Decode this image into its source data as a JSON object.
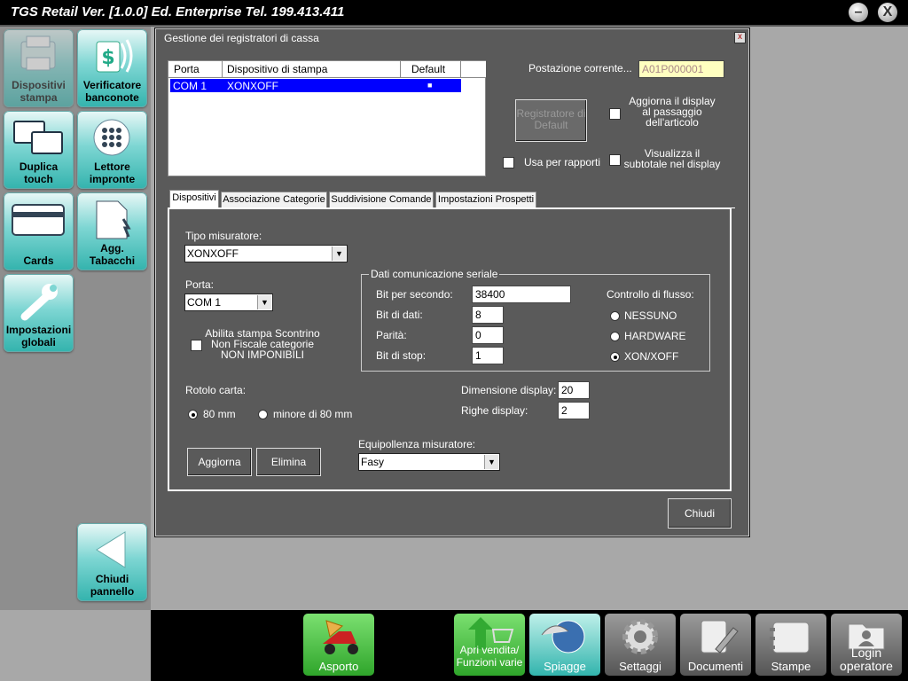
{
  "app": {
    "title": "TGS Retail Ver. [1.0.0] Ed. Enterprise   Tel. 199.413.411",
    "minimize_label": "–",
    "close_label": "X"
  },
  "sidebar": {
    "tiles": [
      {
        "label": "Dispositivi stampa",
        "icon": "printer-device-icon",
        "state": "disabled"
      },
      {
        "label": "Verificatore banconote",
        "icon": "banknote-verifier-icon"
      },
      {
        "label": "Duplica touch",
        "icon": "duplicate-screens-icon"
      },
      {
        "label": "Lettore impronte",
        "icon": "fingerprint-reader-icon"
      },
      {
        "label": "Cards",
        "icon": "card-icon"
      },
      {
        "label": "Agg. Tabacchi",
        "icon": "tobacco-update-icon"
      },
      {
        "label": "Impostazioni globali",
        "icon": "wrench-icon"
      }
    ],
    "close_panel_label": "Chiudi pannello"
  },
  "dialog": {
    "title": "Gestione dei registratori di cassa",
    "close_label": "x",
    "grid": {
      "columns": [
        "Porta",
        "Dispositivo di stampa",
        "Default"
      ],
      "rows": [
        {
          "porta": "COM 1",
          "dispositivo": "XONXOFF",
          "default": "■"
        }
      ]
    },
    "postazione_label": "Postazione corrente...",
    "postazione_value": "A01P000001",
    "registratore_default_label": "Registratore di Default",
    "aggiorna_display_label": "Aggiorna il display al passaggio dell'articolo",
    "usa_per_rapporti_label": "Usa per rapporti",
    "visualizza_subtotale_label": "Visualizza il subtotale nel display",
    "tabs": [
      "Dispositivi",
      "Associazione Categorie",
      "Suddivisione Comande",
      "Impostazioni Prospetti"
    ],
    "active_tab": "Dispositivi",
    "dispositivi": {
      "tipo_misuratore_label": "Tipo misuratore:",
      "tipo_misuratore_value": "XONXOFF",
      "porta_label": "Porta:",
      "porta_value": "COM 1",
      "abilita_stampa_label": "Abilita stampa Scontrino Non Fiscale categorie NON IMPONIBILI",
      "seriale": {
        "title": "Dati comunicazione seriale",
        "bit_per_secondo_label": "Bit per secondo:",
        "bit_per_secondo_value": "38400",
        "bit_di_dati_label": "Bit di dati:",
        "bit_di_dati_value": "8",
        "parita_label": "Parità:",
        "parita_value": "0",
        "bit_di_stop_label": "Bit di stop:",
        "bit_di_stop_value": "1",
        "controllo_flusso_label": "Controllo di flusso:",
        "flusso_options": [
          "NESSUNO",
          "HARDWARE",
          "XON/XOFF"
        ],
        "flusso_selected": "XON/XOFF"
      },
      "rotolo_carta_label": "Rotolo carta:",
      "rotolo_options": [
        "80 mm",
        "minore di 80 mm"
      ],
      "rotolo_selected": "80 mm",
      "dimensione_display_label": "Dimensione display:",
      "dimensione_display_value": "20",
      "righe_display_label": "Righe display:",
      "righe_display_value": "2",
      "equipollenza_label": "Equipollenza misuratore:",
      "equipollenza_value": "Fasy",
      "aggiorna_label": "Aggiorna",
      "elimina_label": "Elimina"
    },
    "chiudi_label": "Chiudi"
  },
  "bottom_bar": [
    {
      "label": "Asporto",
      "icon": "scooter-pizza-icon",
      "style": "green"
    },
    {
      "label": "Apri vendita/ Funzioni varie",
      "icon": "shopping-cart-arrow-icon",
      "style": "green"
    },
    {
      "label": "Spiagge",
      "icon": "beach-umbrella-icon",
      "style": "teal"
    },
    {
      "label": "Settaggi",
      "icon": "gear-icon",
      "style": "gray"
    },
    {
      "label": "Documenti",
      "icon": "document-pen-icon",
      "style": "gray"
    },
    {
      "label": "Stampe",
      "icon": "notepad-icon",
      "style": "gray"
    },
    {
      "label": "Login operatore",
      "icon": "user-folder-icon",
      "style": "gray"
    }
  ],
  "colors": {
    "dialog_bg": "#5a5a5a",
    "selection": "#0000ff",
    "tile_accent": "#33b3ad",
    "readonly_field": "#ffffc0"
  }
}
